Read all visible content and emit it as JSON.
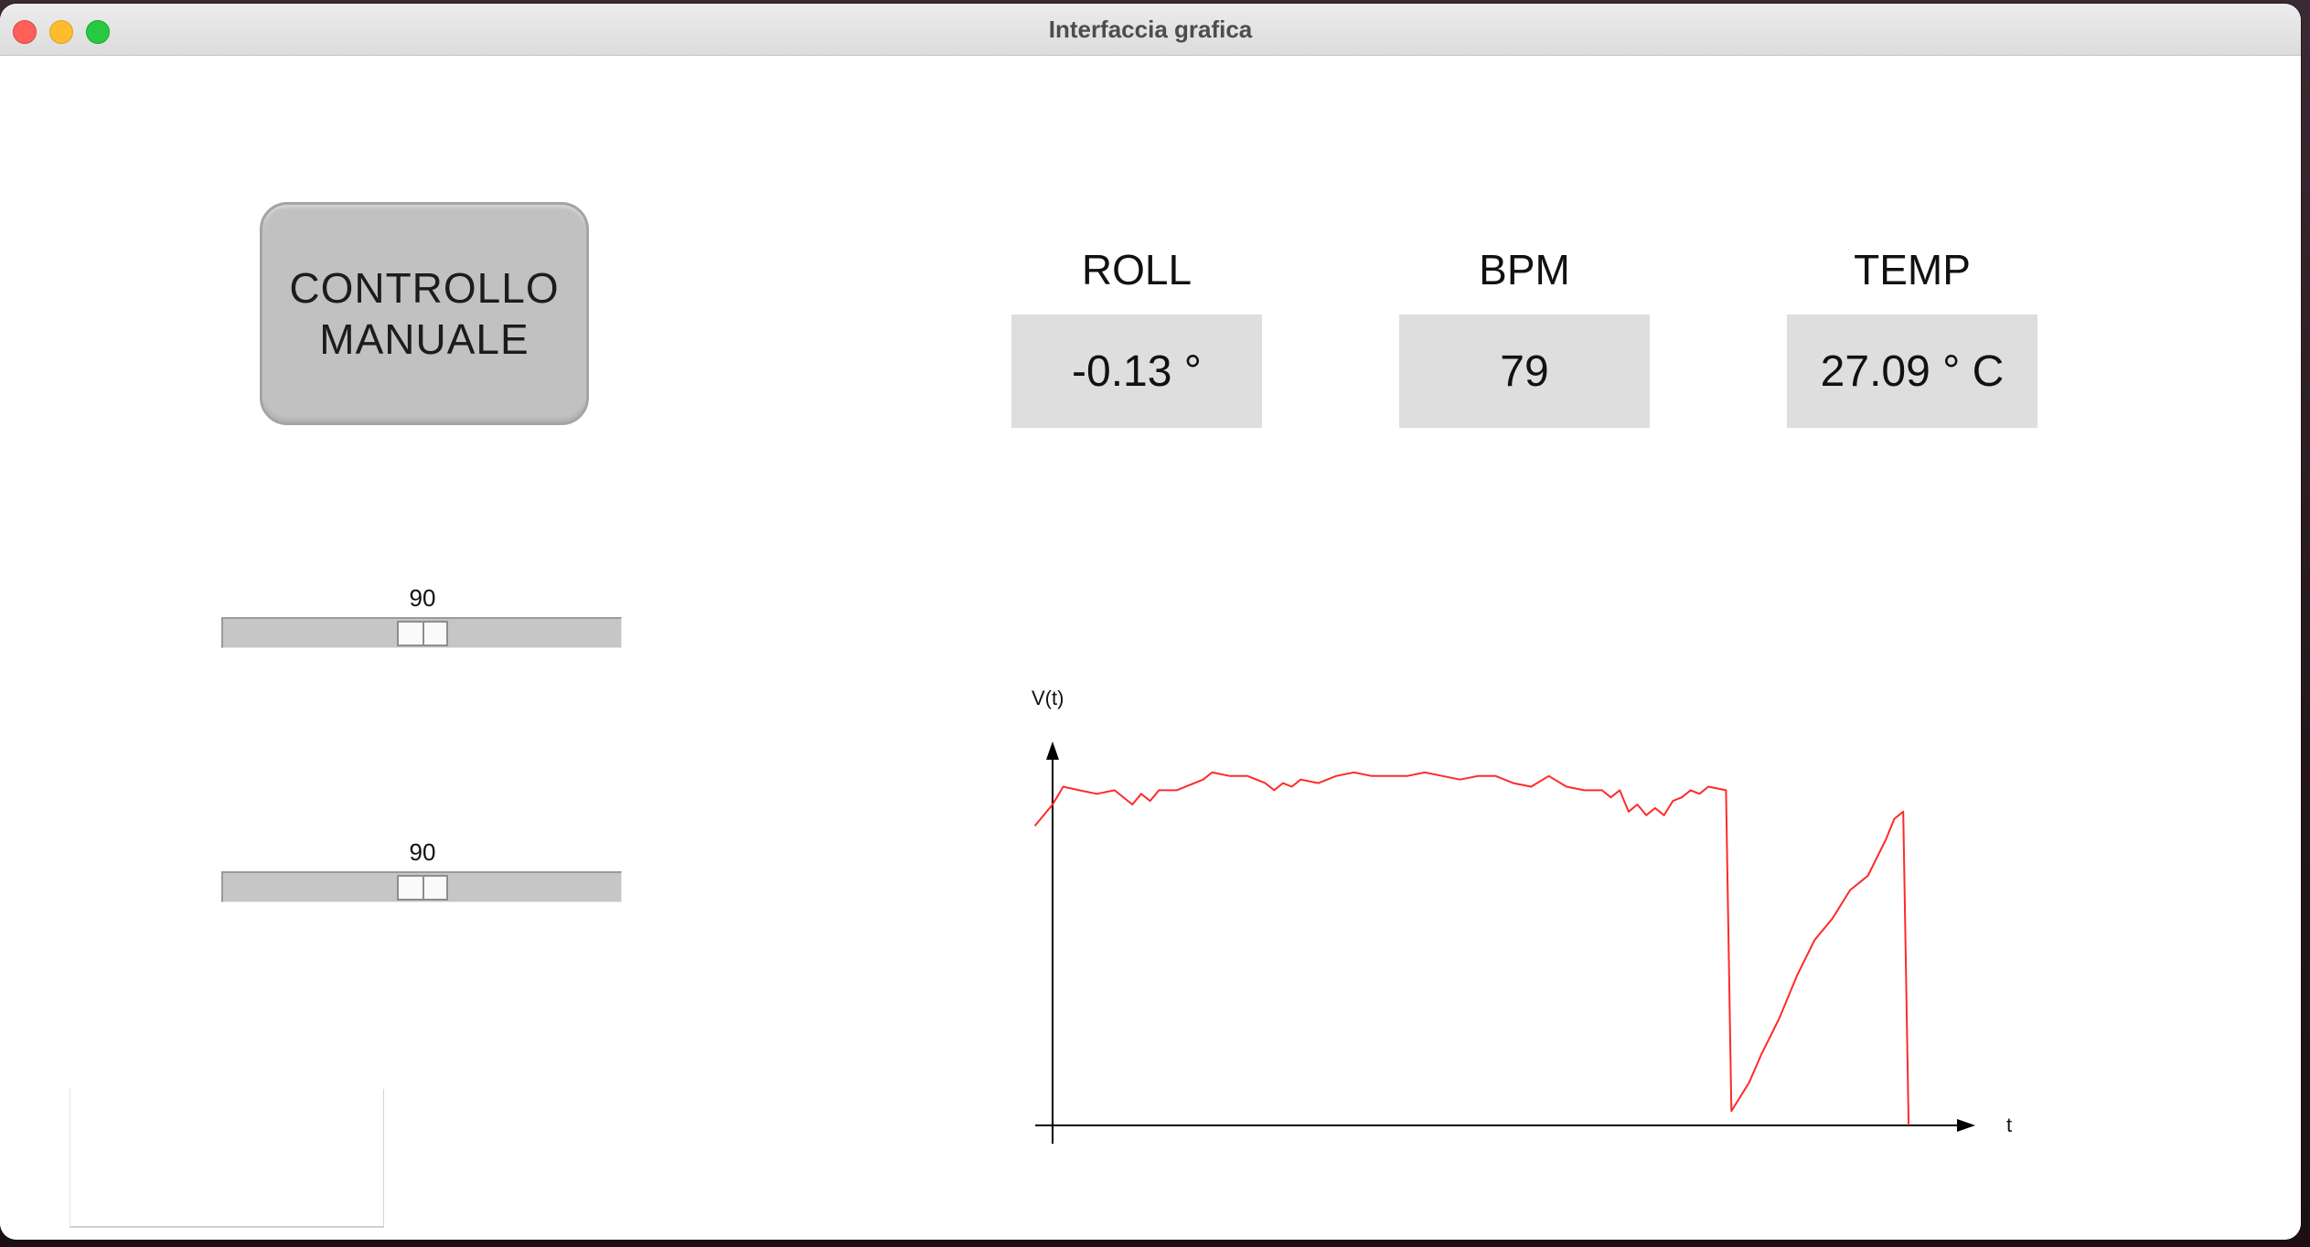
{
  "window": {
    "title": "Interfaccia grafica"
  },
  "manual_button": {
    "label": "CONTROLLO\nMANUALE"
  },
  "sliders": [
    {
      "value_label": "90",
      "value": 90,
      "min": 0,
      "max": 180
    },
    {
      "value_label": "90",
      "value": 90,
      "min": 0,
      "max": 180
    }
  ],
  "metrics": [
    {
      "label": "ROLL",
      "value": "-0.13 °"
    },
    {
      "label": "BPM",
      "value": "79"
    },
    {
      "label": "TEMP",
      "value": "27.09 ° C"
    }
  ],
  "colors": {
    "signal": "#ff2a2a",
    "axis": "#000000",
    "metric_box": "#dedede",
    "button": "#c1c1c1"
  },
  "chart_data": {
    "type": "line",
    "ylabel": "V(t)",
    "xlabel": "t",
    "grid": false,
    "legend": "none",
    "xlim": [
      0,
      1000
    ],
    "ylim": [
      0,
      100
    ],
    "series": [
      {
        "x": [
          -20,
          0,
          12,
          30,
          50,
          70,
          90,
          100,
          110,
          120,
          140,
          160,
          170,
          180,
          200,
          220,
          240,
          250,
          260,
          270,
          280,
          300,
          320,
          340,
          360,
          380,
          400,
          420,
          440,
          460,
          480,
          500,
          520,
          540,
          560,
          580,
          600,
          620,
          630,
          640,
          650,
          660,
          670,
          680,
          690,
          700,
          710,
          720,
          730,
          740,
          760,
          766,
          786,
          800,
          820,
          840,
          860,
          880,
          900,
          920,
          940,
          950,
          960,
          966
        ],
        "y": [
          84,
          90,
          95,
          94,
          93,
          94,
          90,
          93,
          91,
          94,
          94,
          96,
          97,
          99,
          98,
          98,
          96,
          94,
          96,
          95,
          97,
          96,
          98,
          99,
          98,
          98,
          98,
          99,
          98,
          97,
          98,
          98,
          96,
          95,
          98,
          95,
          94,
          94,
          92,
          94,
          88,
          90,
          87,
          89,
          87,
          91,
          92,
          94,
          93,
          95,
          94,
          4,
          12,
          20,
          30,
          42,
          52,
          58,
          66,
          70,
          80,
          86,
          88,
          0
        ]
      }
    ]
  }
}
